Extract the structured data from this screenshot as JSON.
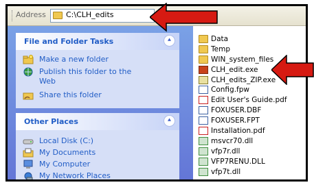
{
  "address_bar": {
    "label": "Address",
    "path": "C:\\CLH_edits"
  },
  "tasks_panel": {
    "title": "File and Folder Tasks",
    "items": [
      {
        "label": "Make a new folder",
        "icon": "new-folder-icon"
      },
      {
        "label": "Publish this folder to the Web",
        "icon": "globe-publish-icon"
      },
      {
        "label": "Share this folder",
        "icon": "share-folder-icon"
      }
    ]
  },
  "places_panel": {
    "title": "Other Places",
    "items": [
      {
        "label": "Local Disk (C:)",
        "icon": "disk-drive-icon"
      },
      {
        "label": "My Documents",
        "icon": "documents-folder-icon"
      },
      {
        "label": "My Computer",
        "icon": "computer-icon"
      },
      {
        "label": "My Network Places",
        "icon": "network-icon"
      }
    ]
  },
  "files": [
    {
      "name": "Data",
      "icon": "folder-icon"
    },
    {
      "name": "Temp",
      "icon": "folder-icon"
    },
    {
      "name": "WIN_system_files",
      "icon": "folder-icon"
    },
    {
      "name": "CLH_edit.exe",
      "icon": "exe-icon"
    },
    {
      "name": "CLH_edits_ZIP.exe",
      "icon": "zip-exe-icon"
    },
    {
      "name": "Config.fpw",
      "icon": "config-file-icon"
    },
    {
      "name": "Edit User's Guide.pdf",
      "icon": "pdf-icon"
    },
    {
      "name": "FOXUSER.DBF",
      "icon": "dbf-file-icon"
    },
    {
      "name": "FOXUSER.FPT",
      "icon": "fpt-file-icon"
    },
    {
      "name": "Installation.pdf",
      "icon": "pdf-icon"
    },
    {
      "name": "msvcr70.dll",
      "icon": "dll-icon"
    },
    {
      "name": "vfp7r.dll",
      "icon": "dll-icon"
    },
    {
      "name": "VFP7RENU.DLL",
      "icon": "dll-icon"
    },
    {
      "name": "vfp7t.dll",
      "icon": "dll-icon"
    }
  ],
  "colors": {
    "arrow": "#d61a12",
    "link": "#215dc6",
    "pane_bg": "#6f8be0",
    "panel_bg": "#d6dff7"
  }
}
